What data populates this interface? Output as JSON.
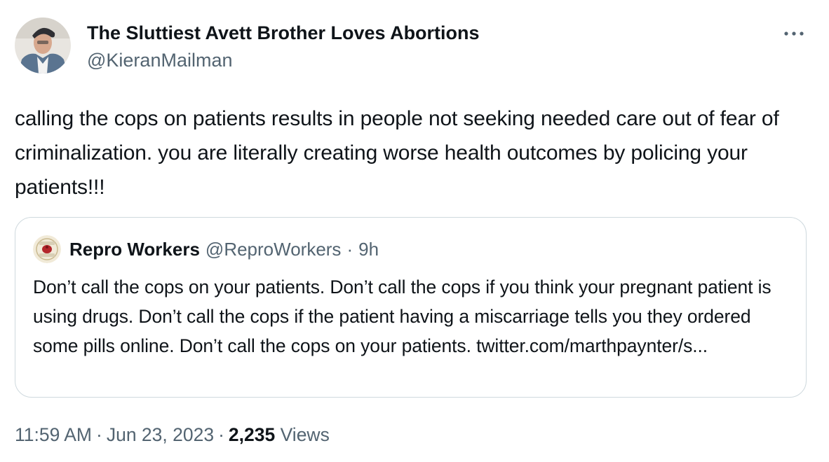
{
  "tweet": {
    "author": {
      "display_name": "The Sluttiest Avett Brother Loves Abortions",
      "handle": "@KieranMailman",
      "avatar_icon": "user-avatar-photo"
    },
    "more_icon": "more-horizontal-icon",
    "text": "calling the cops on patients results in people not seeking needed care out of fear of criminalization. you are literally creating worse health outcomes by policing your patients!!!",
    "quoted": {
      "display_name": "Repro Workers",
      "handle": "@ReproWorkers",
      "separator": "·",
      "time_ago": "9h",
      "avatar_icon": "repro-workers-logo",
      "text": "Don’t call the cops on your patients. Don’t call the cops if you think your pregnant patient is using drugs. Don’t call the cops if the patient having a miscarriage tells you they ordered some pills online. Don’t call the cops on your patients. twitter.com/marthpaynter/s..."
    },
    "meta": {
      "time": "11:59 AM",
      "separator": "·",
      "date": "Jun 23, 2023",
      "views_count": "2,235",
      "views_label": "Views"
    }
  },
  "colors": {
    "text_primary": "#0f1419",
    "text_secondary": "#536471",
    "border": "#cfd9de"
  }
}
